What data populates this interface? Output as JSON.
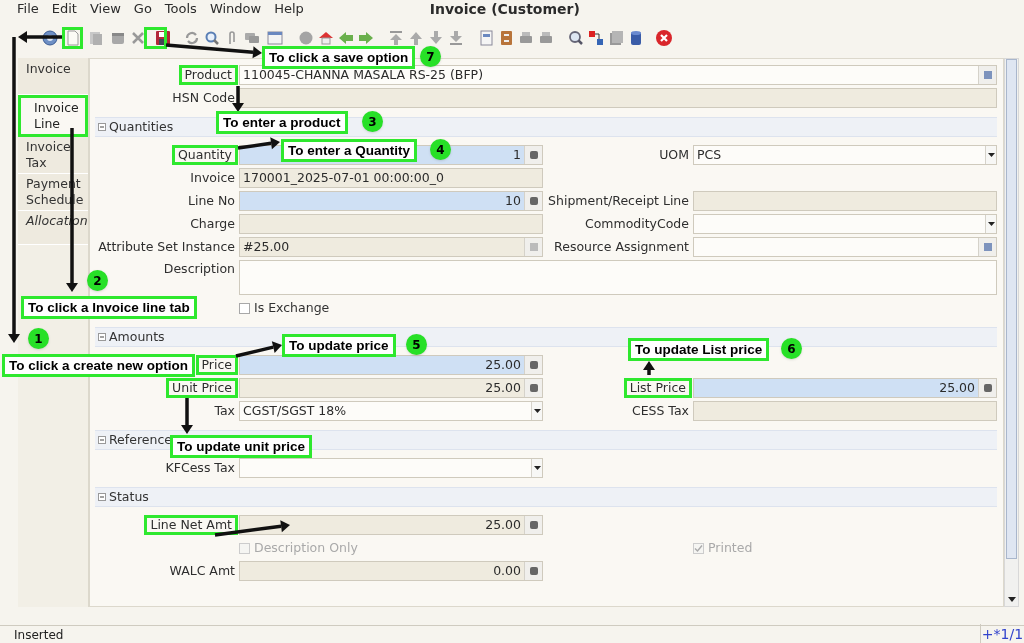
{
  "menu": [
    "File",
    "Edit",
    "View",
    "Go",
    "Tools",
    "Window",
    "Help"
  ],
  "window": {
    "title": "Invoice (Customer)"
  },
  "tabs": [
    {
      "label": "Invoice",
      "selected": false,
      "disabled": false,
      "highlighted": false
    },
    {
      "label": "Invoice Line",
      "selected": true,
      "disabled": false,
      "highlighted": true
    },
    {
      "label": "Invoice Tax",
      "selected": false,
      "disabled": false,
      "highlighted": false
    },
    {
      "label": "Payment Schedule",
      "selected": false,
      "disabled": false,
      "highlighted": false
    },
    {
      "label": "Allocation",
      "selected": false,
      "disabled": true,
      "highlighted": false
    }
  ],
  "sections": [
    {
      "rows": [
        {
          "left": {
            "label": "Product",
            "value": "110045-CHANNA MASALA RS-25 (BFP)",
            "kind": "lookup",
            "mandatory": false,
            "readonly": false,
            "wide": true,
            "highlighted": true
          }
        },
        {
          "left": {
            "label": "HSN Code",
            "kind": "text",
            "mandatory": false,
            "readonly": true,
            "wide": true,
            "highlighted": false
          }
        }
      ]
    },
    {
      "title": "Quantities",
      "expanded": true,
      "rows": [
        {
          "left": {
            "label": "Quantity",
            "value": "1",
            "kind": "number",
            "mandatory": true,
            "readonly": false,
            "highlighted": true
          },
          "right": {
            "label": "UOM",
            "value": "PCS",
            "kind": "select",
            "mandatory": false,
            "readonly": false,
            "highlighted": false
          }
        },
        {
          "left": {
            "label": "Invoice",
            "value": "170001_2025-07-01 00:00:00_0",
            "kind": "text",
            "mandatory": false,
            "readonly": true,
            "highlighted": false
          }
        },
        {
          "left": {
            "label": "Line No",
            "value": "10",
            "kind": "number",
            "mandatory": true,
            "readonly": false,
            "highlighted": false
          },
          "right": {
            "label": "Shipment/Receipt Line",
            "kind": "text",
            "mandatory": false,
            "readonly": true,
            "highlighted": false
          }
        },
        {
          "left": {
            "label": "Charge",
            "kind": "text",
            "mandatory": false,
            "readonly": true,
            "highlighted": false
          },
          "right": {
            "label": "CommodityCode",
            "kind": "select",
            "mandatory": false,
            "readonly": false,
            "highlighted": false
          }
        },
        {
          "left": {
            "label": "Attribute Set Instance",
            "value": "#25.00",
            "kind": "lookup",
            "mandatory": false,
            "readonly": true,
            "highlighted": false
          },
          "right": {
            "label": "Resource Assignment",
            "kind": "lookup",
            "mandatory": false,
            "readonly": false,
            "highlighted": false
          }
        },
        {
          "left": {
            "label": "Description",
            "kind": "textarea",
            "mandatory": false,
            "readonly": false,
            "wide": true,
            "highlighted": false
          }
        },
        {
          "left": {
            "label": "Is Exchange",
            "kind": "checkbox",
            "checked": false,
            "disabled": false
          }
        }
      ]
    },
    {
      "title": "Amounts",
      "expanded": true,
      "rows": [
        {
          "left": {
            "label": "Price",
            "value": "25.00",
            "kind": "number",
            "mandatory": true,
            "readonly": false,
            "highlighted": true
          }
        },
        {
          "left": {
            "label": "Unit Price",
            "value": "25.00",
            "kind": "number",
            "mandatory": false,
            "readonly": true,
            "highlighted": true
          },
          "right": {
            "label": "List Price",
            "value": "25.00",
            "kind": "number",
            "mandatory": true,
            "readonly": false,
            "highlighted": true
          }
        },
        {
          "left": {
            "label": "Tax",
            "value": "CGST/SGST 18%",
            "kind": "select",
            "mandatory": false,
            "readonly": false,
            "highlighted": false
          },
          "right": {
            "label": "CESS Tax",
            "kind": "text",
            "mandatory": false,
            "readonly": true,
            "highlighted": false
          }
        }
      ]
    },
    {
      "title": "Reference",
      "expanded": true,
      "rows": [
        {
          "left": {
            "label": "KFCess Tax",
            "kind": "select",
            "mandatory": false,
            "readonly": false,
            "highlighted": false
          }
        }
      ]
    },
    {
      "title": "Status",
      "expanded": true,
      "rows": [
        {
          "left": {
            "label": "Line Net Amt",
            "value": "25.00",
            "kind": "number",
            "mandatory": false,
            "readonly": true,
            "highlighted": true
          }
        },
        {
          "left": {
            "label": "Description Only",
            "kind": "checkbox",
            "checked": false,
            "disabled": true
          },
          "right": {
            "label": "Printed",
            "kind": "checkbox",
            "checked": true,
            "disabled": true
          }
        },
        {
          "left": {
            "label": "WALC Amt",
            "value": "0.00",
            "kind": "number",
            "mandatory": false,
            "readonly": true,
            "highlighted": false
          }
        }
      ]
    }
  ],
  "annotations": [
    {
      "text": "To click a save option",
      "number": "7"
    },
    {
      "text": "To enter a product",
      "number": "3"
    },
    {
      "text": "To enter a Quantity",
      "number": "4"
    },
    {
      "text": "To click a Invoice line tab",
      "number": "2"
    },
    {
      "text": "To click a create new option",
      "number": "1"
    },
    {
      "text": "To update price",
      "number": "5"
    },
    {
      "text": "To update List price",
      "number": "6"
    },
    {
      "text": "To update unit price"
    }
  ],
  "status_bar": {
    "message": "Inserted",
    "record": "+*1/1"
  }
}
